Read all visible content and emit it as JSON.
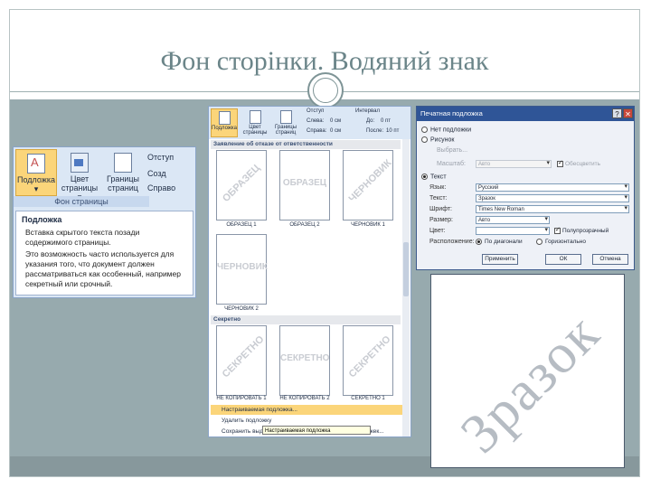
{
  "slide": {
    "title": "Фон сторінки. Водяний знак"
  },
  "colors": {
    "title": "#6b8589",
    "content_band": "#97aaae",
    "footer_band": "#87989c",
    "ribbon": "#dbe7f5",
    "active_button": "#fbd57a",
    "dialog_titlebar": "#2f5597"
  },
  "ribbon": {
    "buttons": [
      {
        "label": "Подложка",
        "sub": "▾",
        "icon": "watermark-icon"
      },
      {
        "label": "Цвет",
        "sub": "страницы ▾",
        "icon": "page-color-icon"
      },
      {
        "label": "Границы",
        "sub": "страниц",
        "icon": "page-borders-icon"
      }
    ],
    "side_items": [
      "Отступ",
      "Созд",
      "Справо"
    ],
    "group_label": "Фон страницы",
    "tooltip": {
      "title": "Подложка",
      "text1": "Вставка скрытого текста позади содержимого страницы.",
      "text2": "Это возможность часто используется для указания того, что документ должен рассматриваться как особенный, например секретный или срочный."
    }
  },
  "gallery": {
    "ribbon_buttons": [
      {
        "label": "Подложка"
      },
      {
        "label": "Цвет страницы"
      },
      {
        "label": "Границы страниц"
      }
    ],
    "fields": {
      "otstup": "Отступ",
      "interval": "Интервал",
      "sleva": "Слева:",
      "sprava": "Справа:",
      "do": "До:",
      "posle": "После:",
      "v1": "0 см",
      "v2": "0 см",
      "v3": "0 пт",
      "v4": "10 пт"
    },
    "section1": "Заявление об отказе от ответственности",
    "section2": "Секретно",
    "thumbs_row1": [
      {
        "wm": "ОБРАЗЕЦ",
        "caption": "ОБРАЗЕЦ 1",
        "rotated": true
      },
      {
        "wm": "ОБРАЗЕЦ",
        "caption": "ОБРАЗЕЦ 2",
        "rotated": false
      },
      {
        "wm": "ЧЕРНОВИК",
        "caption": "ЧЕРНОВИК 1",
        "rotated": true
      }
    ],
    "thumbs_row2": [
      {
        "wm": "ЧЕРНОВИК",
        "caption": "ЧЕРНОВИК 2",
        "rotated": false
      }
    ],
    "thumbs_row3": [
      {
        "wm": "СЕКРЕТНО",
        "caption": "НЕ КОПИРОВАТЬ 1",
        "rotated": true
      },
      {
        "wm": "СЕКРЕТНО",
        "caption": "НЕ КОПИРОВАТЬ 2",
        "rotated": false
      },
      {
        "wm": "СЕКРЕТНО",
        "caption": "СЕКРЕТНО 1",
        "rotated": true
      }
    ],
    "menu": [
      "Настраиваемая подложка...",
      "Удалить подложку",
      "Сохранить выделенный фрагмент в коллекцию подложек..."
    ],
    "menu_tooltip": "Настраиваемая подложка"
  },
  "dialog": {
    "title": "Печатная подложка",
    "radio_none": "Нет подложки",
    "radio_picture": "Рисунок",
    "choose_picture": "Выбрать...",
    "scale_label": "Масштаб:",
    "scale_value": "Авто",
    "washout": "Обесцветить",
    "radio_text": "Текст",
    "lang_label": "Язык:",
    "lang_value": "Русский",
    "text_label": "Текст:",
    "text_value": "Зразок",
    "font_label": "Шрифт:",
    "font_value": "Times New Roman",
    "size_label": "Размер:",
    "size_value": "Авто",
    "color_label": "Цвет:",
    "semitransparent": "Полупрозрачный",
    "layout_label": "Расположение:",
    "layout_diag": "По диагонали",
    "layout_horiz": "Горизонтально",
    "btn_apply": "Применить",
    "btn_ok": "ОК",
    "btn_cancel": "Отмена"
  },
  "preview": {
    "watermark_text": "Зразок"
  }
}
